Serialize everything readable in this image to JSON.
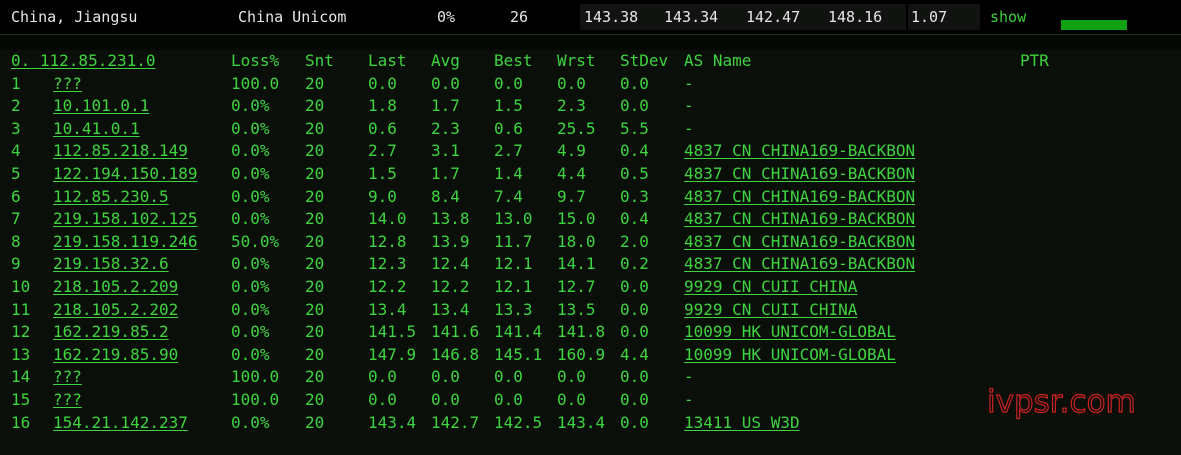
{
  "topbar": {
    "location": "China, Jiangsu",
    "isp": "China Unicom",
    "loss": "0%",
    "count": "26",
    "last": "143.38",
    "avg": "143.34",
    "best": "142.47",
    "worst": "148.16",
    "stdev": "1.07",
    "show_label": "show",
    "status_color": "#11a011"
  },
  "headers": {
    "hop_host": "0.   112.85.231.0",
    "loss": "Loss%",
    "snt": "Snt",
    "last": "Last",
    "avg": "Avg",
    "best": "Best",
    "wrst": "Wrst",
    "stdev": "StDev",
    "as_name": "AS Name",
    "ptr": "PTR"
  },
  "hops": [
    {
      "hop": "1",
      "host": "???",
      "loss": "100.0",
      "snt": "20",
      "last": "0.0",
      "avg": "0.0",
      "best": "0.0",
      "wrst": "0.0",
      "stdev": "0.0",
      "as": "-"
    },
    {
      "hop": "2",
      "host": "10.101.0.1",
      "loss": "0.0%",
      "snt": "20",
      "last": "1.8",
      "avg": "1.7",
      "best": "1.5",
      "wrst": "2.3",
      "stdev": "0.0",
      "as": "-"
    },
    {
      "hop": "3",
      "host": "10.41.0.1",
      "loss": "0.0%",
      "snt": "20",
      "last": "0.6",
      "avg": "2.3",
      "best": "0.6",
      "wrst": "25.5",
      "stdev": "5.5",
      "as": "-"
    },
    {
      "hop": "4",
      "host": "112.85.218.149",
      "loss": "0.0%",
      "snt": "20",
      "last": "2.7",
      "avg": "3.1",
      "best": "2.7",
      "wrst": "4.9",
      "stdev": "0.4",
      "as": "4837  CN CHINA169-BACKBON"
    },
    {
      "hop": "5",
      "host": "122.194.150.189",
      "loss": "0.0%",
      "snt": "20",
      "last": "1.5",
      "avg": "1.7",
      "best": "1.4",
      "wrst": "4.4",
      "stdev": "0.5",
      "as": "4837  CN CHINA169-BACKBON"
    },
    {
      "hop": "6",
      "host": "112.85.230.5",
      "loss": "0.0%",
      "snt": "20",
      "last": "9.0",
      "avg": "8.4",
      "best": "7.4",
      "wrst": "9.7",
      "stdev": "0.3",
      "as": "4837  CN CHINA169-BACKBON"
    },
    {
      "hop": "7",
      "host": "219.158.102.125",
      "loss": "0.0%",
      "snt": "20",
      "last": "14.0",
      "avg": "13.8",
      "best": "13.0",
      "wrst": "15.0",
      "stdev": "0.4",
      "as": "4837  CN CHINA169-BACKBON"
    },
    {
      "hop": "8",
      "host": "219.158.119.246",
      "loss": "50.0%",
      "snt": "20",
      "last": "12.8",
      "avg": "13.9",
      "best": "11.7",
      "wrst": "18.0",
      "stdev": "2.0",
      "as": "4837  CN CHINA169-BACKBON"
    },
    {
      "hop": "9",
      "host": "219.158.32.6",
      "loss": "0.0%",
      "snt": "20",
      "last": "12.3",
      "avg": "12.4",
      "best": "12.1",
      "wrst": "14.1",
      "stdev": "0.2",
      "as": "4837  CN CHINA169-BACKBON"
    },
    {
      "hop": "10",
      "host": "218.105.2.209",
      "loss": "0.0%",
      "snt": "20",
      "last": "12.2",
      "avg": "12.2",
      "best": "12.1",
      "wrst": "12.7",
      "stdev": "0.0",
      "as": "9929  CN CUII CHINA"
    },
    {
      "hop": "11",
      "host": "218.105.2.202",
      "loss": "0.0%",
      "snt": "20",
      "last": "13.4",
      "avg": "13.4",
      "best": "13.3",
      "wrst": "13.5",
      "stdev": "0.0",
      "as": "9929  CN CUII CHINA"
    },
    {
      "hop": "12",
      "host": "162.219.85.2",
      "loss": "0.0%",
      "snt": "20",
      "last": "141.5",
      "avg": "141.6",
      "best": "141.4",
      "wrst": "141.8",
      "stdev": "0.0",
      "as": "10099 HK UNICOM-GLOBAL"
    },
    {
      "hop": "13",
      "host": "162.219.85.90",
      "loss": "0.0%",
      "snt": "20",
      "last": "147.9",
      "avg": "146.8",
      "best": "145.1",
      "wrst": "160.9",
      "stdev": "4.4",
      "as": "10099 HK UNICOM-GLOBAL"
    },
    {
      "hop": "14",
      "host": "???",
      "loss": "100.0",
      "snt": "20",
      "last": "0.0",
      "avg": "0.0",
      "best": "0.0",
      "wrst": "0.0",
      "stdev": "0.0",
      "as": "-"
    },
    {
      "hop": "15",
      "host": "???",
      "loss": "100.0",
      "snt": "20",
      "last": "0.0",
      "avg": "0.0",
      "best": "0.0",
      "wrst": "0.0",
      "stdev": "0.0",
      "as": "-"
    },
    {
      "hop": "16",
      "host": "154.21.142.237",
      "loss": "0.0%",
      "snt": "20",
      "last": "143.4",
      "avg": "142.7",
      "best": "142.5",
      "wrst": "143.4",
      "stdev": "0.0",
      "as": "13411 US W3D"
    }
  ],
  "watermark": "ivpsr.com"
}
